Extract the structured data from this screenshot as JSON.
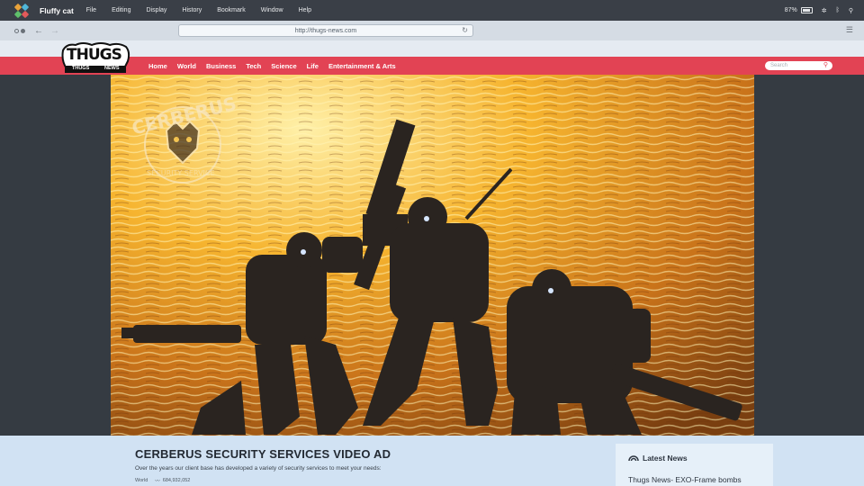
{
  "os": {
    "app_name": "Fluffy cat",
    "menu": [
      "File",
      "Editing",
      "Display",
      "History",
      "Bookmark",
      "Window",
      "Help"
    ],
    "battery_percent": "87%"
  },
  "browser": {
    "url": "http://thugs-news.com"
  },
  "site": {
    "logo_main": "THUGS",
    "logo_left": "THUGS",
    "logo_right": "NEWS",
    "nav": [
      "Home",
      "World",
      "Business",
      "Tech",
      "Science",
      "Life",
      "Entertainment & Arts"
    ],
    "search_placeholder": "Search",
    "accent": "#e24354"
  },
  "hero": {
    "watermark_top": "CERBERUS",
    "watermark_bottom": "SECURITY SERVICE"
  },
  "article": {
    "headline": "CERBERUS SECURITY SERVICES VIDEO AD",
    "summary": "Over the years our client base has developed a variety of security services to meet your needs:",
    "category": "World",
    "views": "684,932,052"
  },
  "sidebar": {
    "title": "Latest News",
    "items": [
      "Thugs News- EXO-Frame bombs"
    ]
  }
}
